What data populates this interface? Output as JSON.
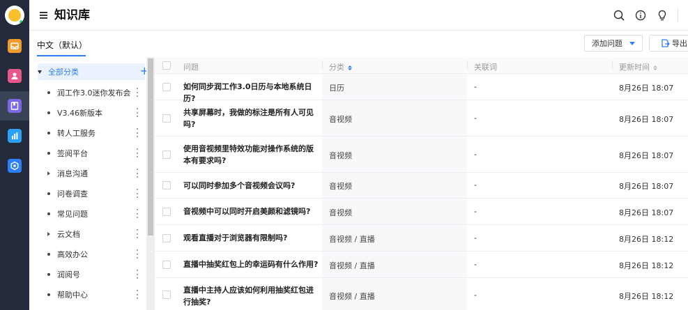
{
  "app": {
    "title": "知识库"
  },
  "rail": {
    "items": [
      {
        "name": "mailbox-icon",
        "color": "#f39a2b"
      },
      {
        "name": "contacts-icon",
        "color": "#e9578c"
      },
      {
        "name": "knowledge-base-icon",
        "color": "#7a68e6",
        "active": true
      },
      {
        "name": "statistics-icon",
        "color": "#2da1f5"
      },
      {
        "name": "settings-icon",
        "color": "#2d7ff9"
      }
    ]
  },
  "header": {
    "icons": [
      "search-icon",
      "info-icon",
      "lightbulb-icon"
    ]
  },
  "tabs": {
    "language": "中文（默认）"
  },
  "toolbar": {
    "add_label": "添加问题",
    "export_label": "导出"
  },
  "categories": {
    "root": "全部分类",
    "items": [
      {
        "label": "润工作3.0迷你发布会",
        "expandable": false
      },
      {
        "label": "V3.46新版本",
        "expandable": false
      },
      {
        "label": "转人工服务",
        "expandable": false
      },
      {
        "label": "签阅平台",
        "expandable": false
      },
      {
        "label": "消息沟通",
        "expandable": true
      },
      {
        "label": "问卷调查",
        "expandable": false
      },
      {
        "label": "常见问题",
        "expandable": false
      },
      {
        "label": "云文档",
        "expandable": true
      },
      {
        "label": "高效办公",
        "expandable": false
      },
      {
        "label": "润阅号",
        "expandable": false
      },
      {
        "label": "帮助中心",
        "expandable": false
      }
    ]
  },
  "table": {
    "columns": {
      "question": "问题",
      "category": "分类",
      "keywords": "关联词",
      "updated": "更新时间"
    },
    "rows": [
      {
        "question": "如何同步润工作3.0日历与本地系统日历?",
        "category": "日历",
        "keywords": "-",
        "updated": "8月26日 18:07"
      },
      {
        "question": "共享屏幕时，我做的标注是所有人可见吗?",
        "category": "音视频",
        "keywords": "-",
        "updated": "8月26日 18:07"
      },
      {
        "question": "使用音视频里特效功能对操作系统的版本有要求吗?",
        "category": "音视频",
        "keywords": "-",
        "updated": "8月26日 18:07"
      },
      {
        "question": "可以同时参加多个音视频会议吗?",
        "category": "音视频",
        "keywords": "-",
        "updated": "8月26日 18:07"
      },
      {
        "question": "音视频中可以同时开启美颜和滤镜吗?",
        "category": "音视频",
        "keywords": "-",
        "updated": "8月26日 18:07"
      },
      {
        "question": "观看直播对于浏览器有限制吗?",
        "category": "音视频 / 直播",
        "keywords": "-",
        "updated": "8月26日 18:12"
      },
      {
        "question": "直播中抽奖红包上的幸运码有什么作用?",
        "category": "音视频 / 直播",
        "keywords": "-",
        "updated": "8月26日 18:12"
      },
      {
        "question": "直播中主持人应该如何利用抽奖红包进行抽奖?",
        "category": "音视频 / 直播",
        "keywords": "-",
        "updated": "8月26日 18:12"
      }
    ]
  }
}
